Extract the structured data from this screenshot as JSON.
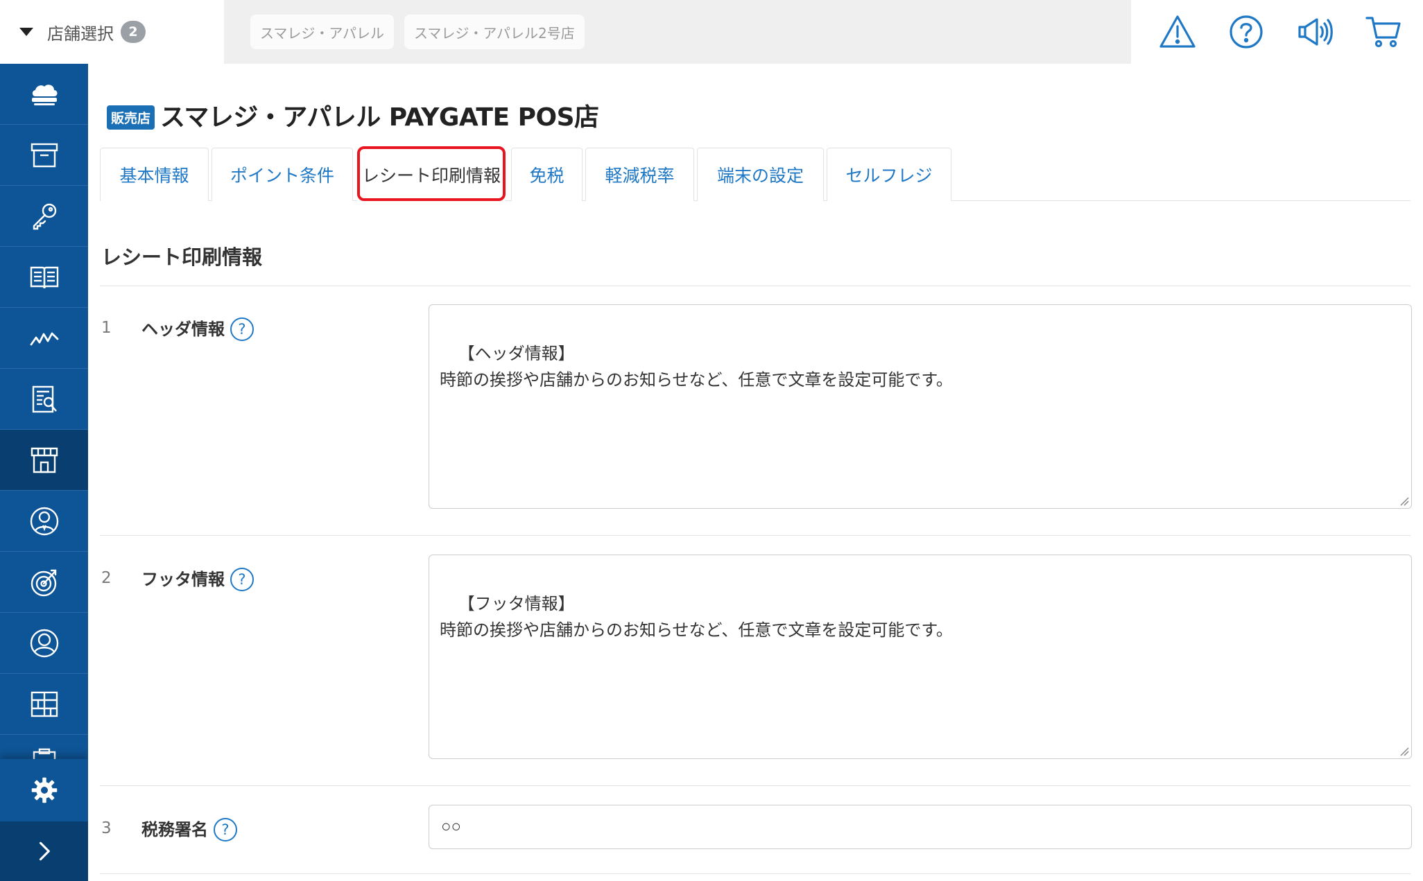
{
  "topbar": {
    "store_select_label": "店舗選択",
    "store_select_count": "2",
    "selected_stores": [
      "スマレジ・アパレル",
      "スマレジ・アパレル2号店"
    ],
    "icons": [
      "warning-icon",
      "help-circle-icon",
      "megaphone-icon",
      "cart-icon"
    ],
    "icon_color": "#1f78c6"
  },
  "sidebar": {
    "items": [
      "cloud-register-icon",
      "archive-box-icon",
      "key-icon",
      "book-icon",
      "analytics-icon",
      "report-search-icon",
      "store-icon",
      "staff-icon",
      "target-icon",
      "customer-icon",
      "grid-apps-icon",
      "clipboard-icon"
    ],
    "active_item": "store-icon",
    "settings_icon": "gear-icon",
    "expand_icon": "chevron-right-icon",
    "background_color": "#0e5597",
    "active_color": "#083e70"
  },
  "header": {
    "badge": "販売店",
    "title": "スマレジ・アパレル PAYGATE POS店"
  },
  "tabs": [
    {
      "label": "基本情報"
    },
    {
      "label": "ポイント条件"
    },
    {
      "label": "レシート印刷情報",
      "active": true
    },
    {
      "label": "免税"
    },
    {
      "label": "軽減税率"
    },
    {
      "label": "端末の設定"
    },
    {
      "label": "セルフレジ"
    }
  ],
  "section": {
    "title": "レシート印刷情報",
    "fields": [
      {
        "number": "1",
        "label": "ヘッダ情報",
        "value": "【ヘッダ情報】\n時節の挨拶や店舗からのお知らせなど、任意で文章を設定可能です。"
      },
      {
        "number": "2",
        "label": "フッタ情報",
        "value": "【フッタ情報】\n時節の挨拶や店舗からのお知らせなど、任意で文章を設定可能です。"
      },
      {
        "number": "3",
        "label": "税務署名",
        "value": "○○"
      }
    ],
    "help_glyph": "?"
  }
}
